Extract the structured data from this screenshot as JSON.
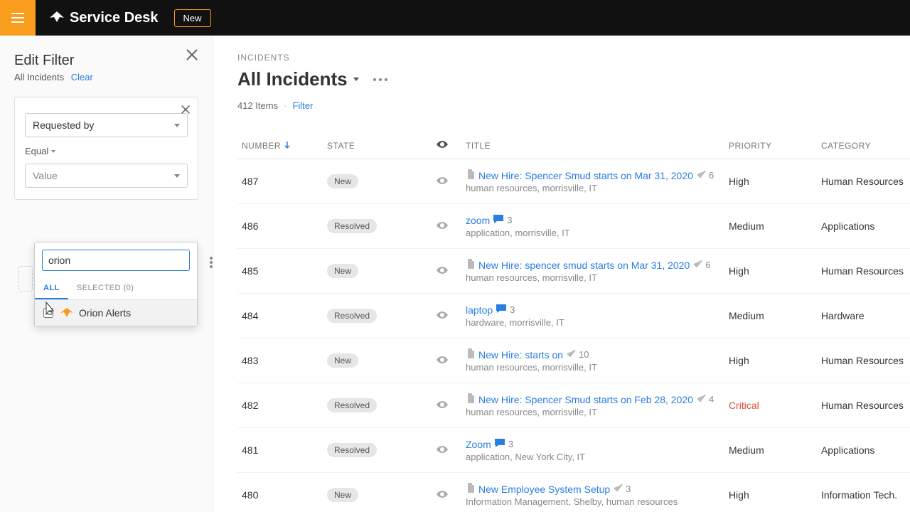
{
  "brand": "Service Desk",
  "new_button": "New",
  "sidebar": {
    "title": "Edit Filter",
    "subtitle": "All Incidents",
    "clear": "Clear",
    "card": {
      "field_label": "Requested by",
      "condition": "Equal",
      "value_placeholder": "Value"
    },
    "popover": {
      "search_value": "orion",
      "tab_all": "ALL",
      "tab_selected": "SELECTED (0)",
      "item_label": "Orion Alerts"
    }
  },
  "main": {
    "crumb": "INCIDENTS",
    "title": "All Incidents",
    "item_count": "412 Items",
    "filter_link": "Filter"
  },
  "columns": {
    "number": "NUMBER",
    "state": "STATE",
    "title": "TITLE",
    "priority": "PRIORITY",
    "category": "CATEGORY"
  },
  "rows": [
    {
      "num": "487",
      "state": "New",
      "doc": true,
      "link": "New Hire: Spencer Smud starts on Mar 31, 2020",
      "comment": false,
      "check": true,
      "count": "6",
      "tags": "human resources, morrisville, IT",
      "priority": "High",
      "category": "Human Resources"
    },
    {
      "num": "486",
      "state": "Resolved",
      "doc": false,
      "link": "zoom",
      "comment": true,
      "check": false,
      "count": "3",
      "tags": "application, morrisville, IT",
      "priority": "Medium",
      "category": "Applications"
    },
    {
      "num": "485",
      "state": "New",
      "doc": true,
      "link": "New Hire: spencer smud starts on Mar 31, 2020",
      "comment": false,
      "check": true,
      "count": "6",
      "tags": "human resources, morrisville, IT",
      "priority": "High",
      "category": "Human Resources"
    },
    {
      "num": "484",
      "state": "Resolved",
      "doc": false,
      "link": "laptop",
      "comment": true,
      "check": false,
      "count": "3",
      "tags": "hardware, morrisville, IT",
      "priority": "Medium",
      "category": "Hardware"
    },
    {
      "num": "483",
      "state": "New",
      "doc": true,
      "link": "New Hire: starts on",
      "comment": false,
      "check": true,
      "count": "10",
      "tags": "human resources, morrisville, IT",
      "priority": "High",
      "category": "Human Resources"
    },
    {
      "num": "482",
      "state": "Resolved",
      "doc": true,
      "link": "New Hire: Spencer Smud starts on Feb 28, 2020",
      "comment": false,
      "check": true,
      "count": "4",
      "tags": "human resources, morrisville, IT",
      "priority": "Critical",
      "category": "Human Resources"
    },
    {
      "num": "481",
      "state": "Resolved",
      "doc": false,
      "link": "Zoom",
      "comment": true,
      "check": false,
      "count": "3",
      "tags": "application, New York City, IT",
      "priority": "Medium",
      "category": "Applications"
    },
    {
      "num": "480",
      "state": "New",
      "doc": true,
      "link": "New Employee System Setup",
      "comment": false,
      "check": true,
      "count": "3",
      "tags": "Information Management, Shelby, human resources",
      "priority": "High",
      "category": "Information Tech."
    }
  ]
}
